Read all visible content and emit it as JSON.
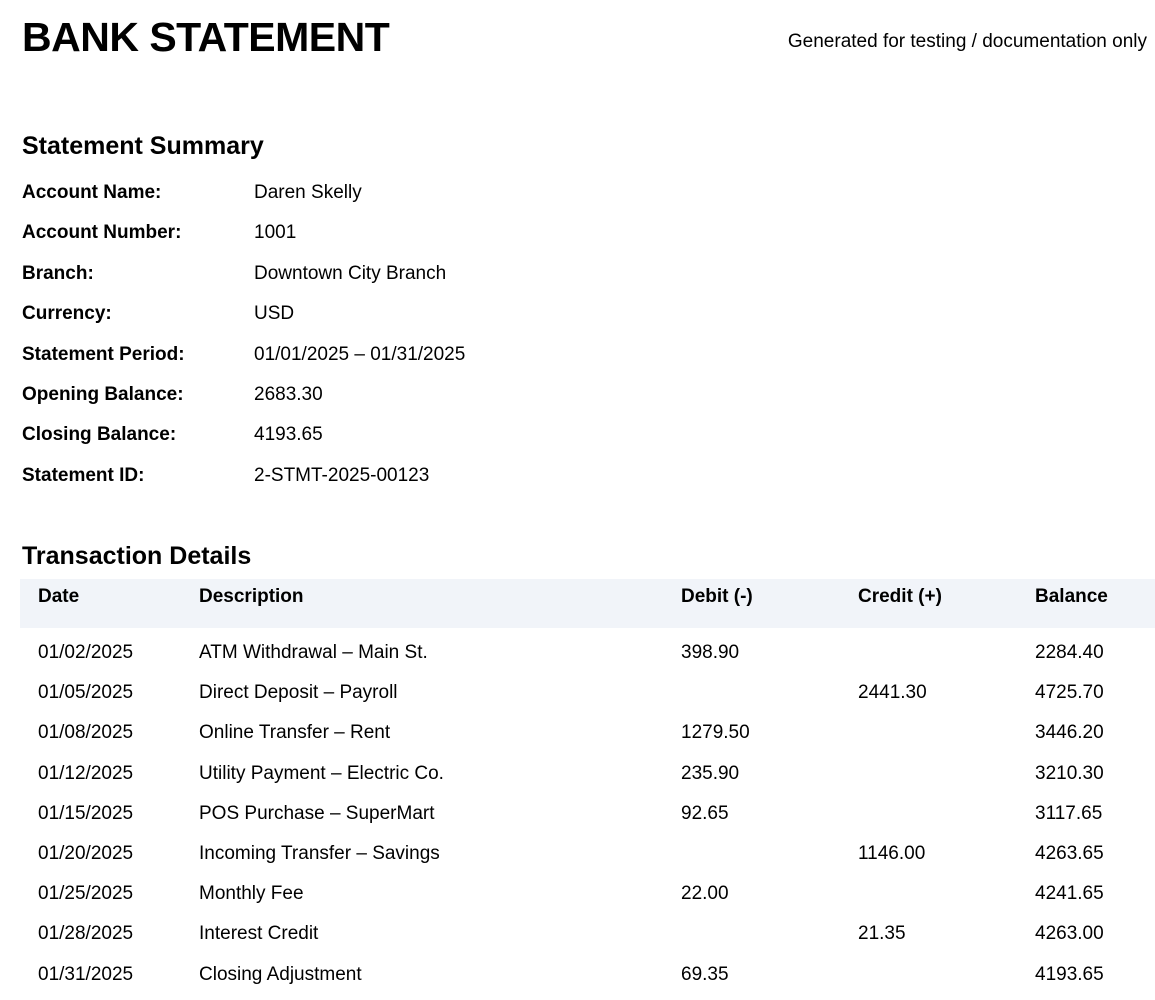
{
  "header": {
    "title": "BANK STATEMENT",
    "note": "Generated for testing / documentation only"
  },
  "summary": {
    "heading": "Statement Summary",
    "rows": [
      {
        "label": "Account Name:",
        "value": "Daren Skelly"
      },
      {
        "label": "Account Number:",
        "value": "1001"
      },
      {
        "label": "Branch:",
        "value": "Downtown City Branch"
      },
      {
        "label": "Currency:",
        "value": "USD"
      },
      {
        "label": "Statement Period:",
        "value": "01/01/2025 – 01/31/2025"
      },
      {
        "label": "Opening Balance:",
        "value": "2683.30"
      },
      {
        "label": "Closing Balance:",
        "value": "4193.65"
      },
      {
        "label": "Statement ID:",
        "value": "2-STMT-2025-00123"
      }
    ]
  },
  "transactions": {
    "heading": "Transaction Details",
    "columns": [
      "Date",
      "Description",
      "Debit (-)",
      "Credit (+)",
      "Balance"
    ],
    "rows": [
      [
        "01/02/2025",
        "ATM Withdrawal – Main St.",
        "398.90",
        "",
        "2284.40"
      ],
      [
        "01/05/2025",
        "Direct Deposit – Payroll",
        "",
        "2441.30",
        "4725.70"
      ],
      [
        "01/08/2025",
        "Online Transfer – Rent",
        "1279.50",
        "",
        "3446.20"
      ],
      [
        "01/12/2025",
        "Utility Payment – Electric Co.",
        "235.90",
        "",
        "3210.30"
      ],
      [
        "01/15/2025",
        "POS Purchase – SuperMart",
        "92.65",
        "",
        "3117.65"
      ],
      [
        "01/20/2025",
        "Incoming Transfer – Savings",
        "",
        "1146.00",
        "4263.65"
      ],
      [
        "01/25/2025",
        "Monthly Fee",
        "22.00",
        "",
        "4241.65"
      ],
      [
        "01/28/2025",
        "Interest Credit",
        "",
        "21.35",
        "4263.00"
      ],
      [
        "01/31/2025",
        "Closing Adjustment",
        "69.35",
        "",
        "4193.65"
      ]
    ]
  }
}
